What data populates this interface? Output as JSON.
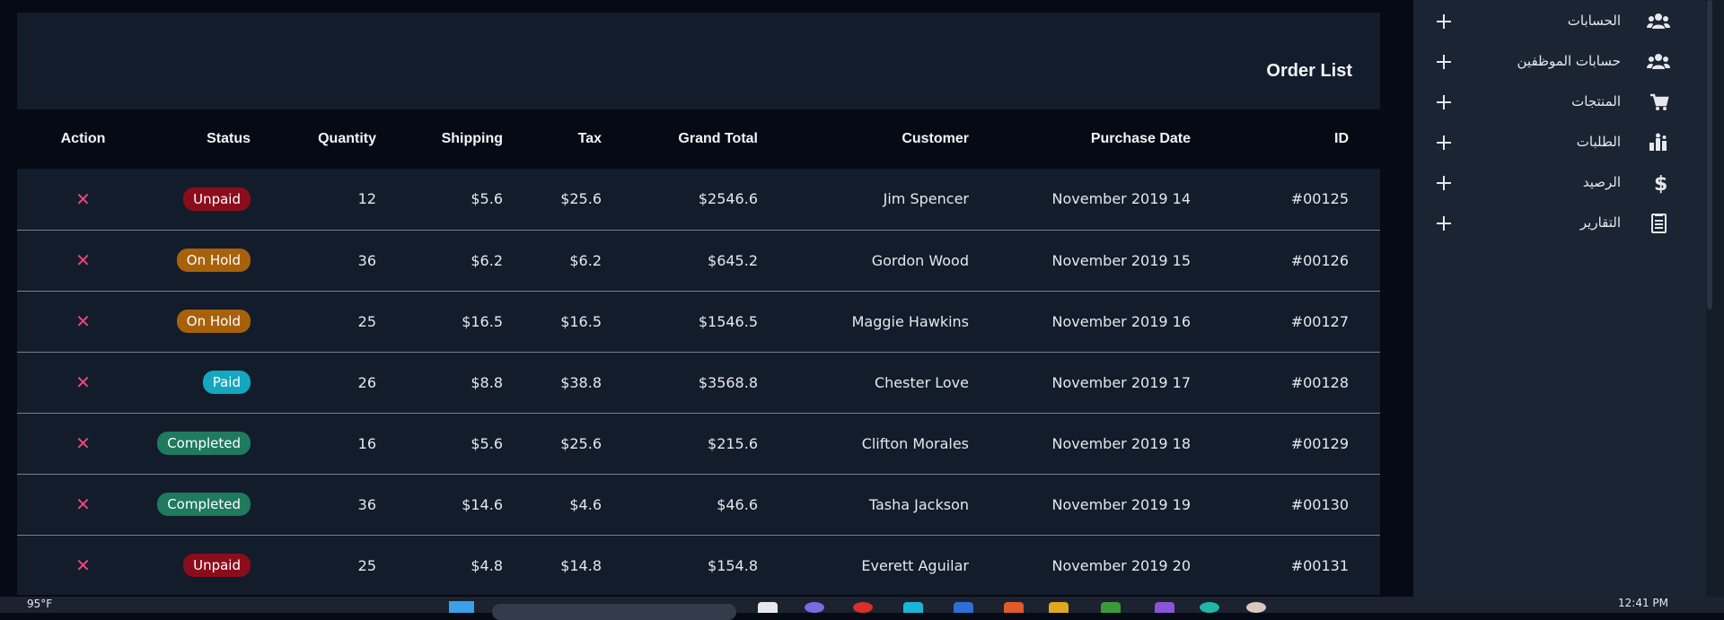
{
  "orders": {
    "title": "Order List",
    "columns": {
      "id": "ID",
      "purchase_date": "Purchase Date",
      "customer": "Customer",
      "grand_total": "Grand Total",
      "tax": "Tax",
      "shipping": "Shipping",
      "quantity": "Quantity",
      "status": "Status",
      "action": "Action"
    },
    "rows": [
      {
        "id": "#00125",
        "date": "November 2019 14",
        "customer": "Jim Spencer",
        "grand_total": "$2546.6",
        "tax": "$25.6",
        "shipping": "$5.6",
        "quantity": "12",
        "status": "Unpaid",
        "action": "✕"
      },
      {
        "id": "#00126",
        "date": "November 2019 15",
        "customer": "Gordon Wood",
        "grand_total": "$645.2",
        "tax": "$6.2",
        "shipping": "$6.2",
        "quantity": "36",
        "status": "On Hold",
        "action": "✕"
      },
      {
        "id": "#00127",
        "date": "November 2019 16",
        "customer": "Maggie Hawkins",
        "grand_total": "$1546.5",
        "tax": "$16.5",
        "shipping": "$16.5",
        "quantity": "25",
        "status": "On Hold",
        "action": "✕"
      },
      {
        "id": "#00128",
        "date": "November 2019 17",
        "customer": "Chester Love",
        "grand_total": "$3568.8",
        "tax": "$38.8",
        "shipping": "$8.8",
        "quantity": "26",
        "status": "Paid",
        "action": "✕"
      },
      {
        "id": "#00129",
        "date": "November 2019 18",
        "customer": "Clifton Morales",
        "grand_total": "$215.6",
        "tax": "$25.6",
        "shipping": "$5.6",
        "quantity": "16",
        "status": "Completed",
        "action": "✕"
      },
      {
        "id": "#00130",
        "date": "November 2019 19",
        "customer": "Tasha Jackson",
        "grand_total": "$46.6",
        "tax": "$4.6",
        "shipping": "$14.6",
        "quantity": "36",
        "status": "Completed",
        "action": "✕"
      },
      {
        "id": "#00131",
        "date": "November 2019 20",
        "customer": "Everett Aguilar",
        "grand_total": "$154.8",
        "tax": "$14.8",
        "shipping": "$4.8",
        "quantity": "25",
        "status": "Unpaid",
        "action": "✕"
      }
    ]
  },
  "status_colors": {
    "Unpaid": "#8b0d1c",
    "On Hold": "#a8610b",
    "Paid": "#15a7bf",
    "Completed": "#1f7a5e"
  },
  "sidebar": {
    "items": [
      {
        "label": "الحسابات",
        "icon": "users-icon"
      },
      {
        "label": "حسابات الموظفين",
        "icon": "users-icon"
      },
      {
        "label": "المنتجات",
        "icon": "cart-icon"
      },
      {
        "label": "الطلبات",
        "icon": "orders-icon"
      },
      {
        "label": "الرصيد",
        "icon": "dollar-icon"
      },
      {
        "label": "التقارير",
        "icon": "report-icon"
      }
    ]
  },
  "taskbar": {
    "weather": "95°F",
    "time": "12:41 PM"
  }
}
